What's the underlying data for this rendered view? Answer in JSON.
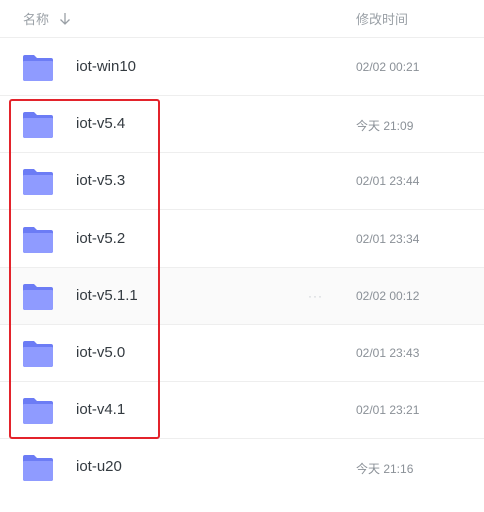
{
  "header": {
    "name_label": "名称",
    "mtime_label": "修改时间",
    "sort_icon": "arrow-down-icon"
  },
  "files": [
    {
      "name": "iot-win10",
      "time": "02/02 00:21"
    },
    {
      "name": "iot-v5.4",
      "time": "今天 21:09"
    },
    {
      "name": "iot-v5.3",
      "time": "02/01 23:44"
    },
    {
      "name": "iot-v5.2",
      "time": "02/01 23:34"
    },
    {
      "name": "iot-v5.1.1",
      "time": "02/02 00:12",
      "more": "···"
    },
    {
      "name": "iot-v5.0",
      "time": "02/01 23:43"
    },
    {
      "name": "iot-v4.1",
      "time": "02/01 23:21"
    },
    {
      "name": "iot-u20",
      "time": "今天 21:16"
    }
  ],
  "colors": {
    "folder_front": "#8f9bff",
    "folder_back": "#6c7cf5",
    "highlight": "#e3232b"
  },
  "icons": {
    "folder": "folder-icon",
    "more": "more-dots-icon"
  }
}
